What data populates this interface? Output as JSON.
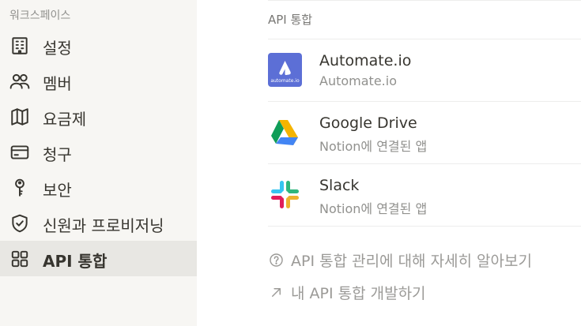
{
  "sidebar": {
    "workspace_label": "워크스페이스",
    "items": [
      {
        "label": "설정",
        "icon": "building-icon",
        "active": false
      },
      {
        "label": "멤버",
        "icon": "people-icon",
        "active": false
      },
      {
        "label": "요금제",
        "icon": "map-icon",
        "active": false
      },
      {
        "label": "청구",
        "icon": "credit-card-icon",
        "active": false
      },
      {
        "label": "보안",
        "icon": "key-icon",
        "active": false
      },
      {
        "label": "신원과 프로비저닝",
        "icon": "shield-check-icon",
        "active": false
      },
      {
        "label": "API 통합",
        "icon": "grid-icon",
        "active": true
      }
    ]
  },
  "main": {
    "section_title": "API 통합",
    "integrations": [
      {
        "name": "Automate.io",
        "subtitle": "Automate.io",
        "logo_text": "automate.io",
        "logo_color": "#5c6fd6"
      },
      {
        "name": "Google Drive",
        "subtitle": "Notion에 연결된 앱"
      },
      {
        "name": "Slack",
        "subtitle": "Notion에 연결된 앱"
      }
    ],
    "links": [
      {
        "label": "API 통합 관리에 대해 자세히 알아보기",
        "icon": "question-circle-icon"
      },
      {
        "label": "내 API 통합 개발하기",
        "icon": "arrow-up-right-icon"
      }
    ]
  },
  "colors": {
    "sidebar_bg": "#f7f6f3",
    "active_bg": "#e8e7e3",
    "text": "#37352f",
    "muted": "#91918e"
  }
}
